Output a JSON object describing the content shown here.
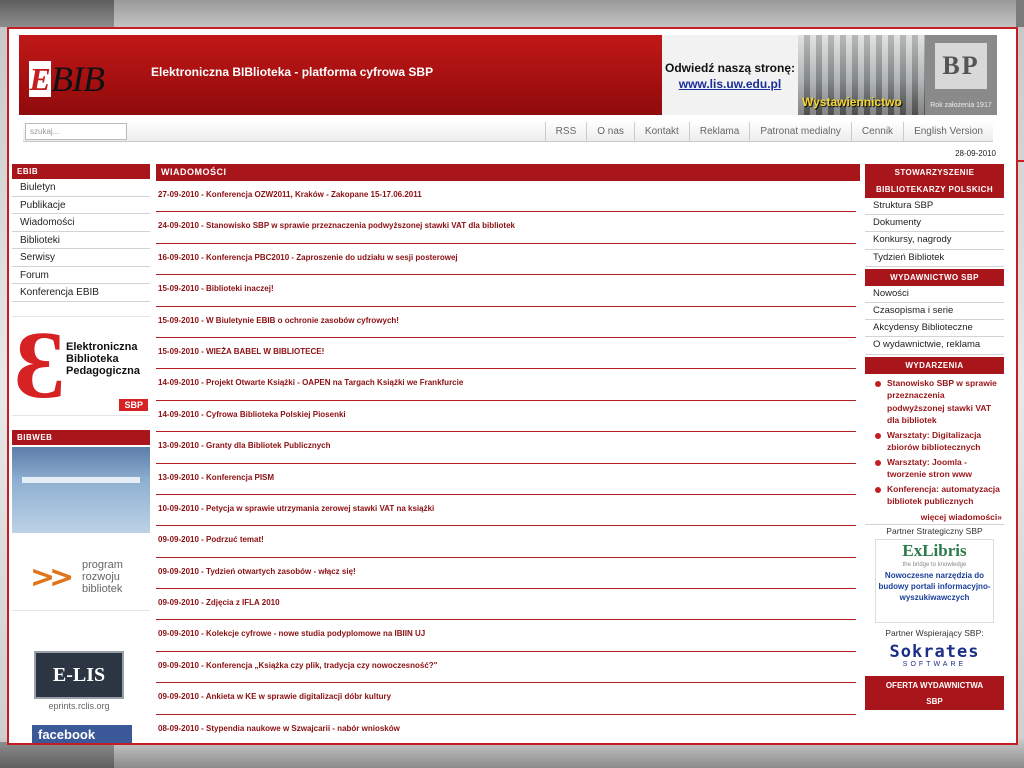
{
  "header": {
    "logo_e": "E",
    "logo_rest": "BIB",
    "title": "Elektroniczna BIBlioteka - platforma cyfrowa SBP",
    "visit_label": "Odwiedź naszą stronę:",
    "visit_url": "www.lis.uw.edu.pl",
    "photo_caption": "Wystawiennictwo",
    "sbp_mark": "BP",
    "sbp_caption": "Rok założenia 1917"
  },
  "navbar": {
    "search_placeholder": "szukaj...",
    "links": [
      "RSS",
      "O nas",
      "Kontakt",
      "Reklama",
      "Patronat medialny",
      "Cennik",
      "English Version"
    ]
  },
  "date": "28-09-2010",
  "left": {
    "ebib_head": "EBIB",
    "menu": [
      "Biuletyn",
      "Publikacje",
      "Wiadomości",
      "Biblioteki",
      "Serwisy",
      "Forum",
      "Konferencja EBIB"
    ],
    "ebp_text": [
      "Elektroniczna",
      "Biblioteka",
      "Pedagogiczna"
    ],
    "ebp_sbp": "SBP",
    "bibweb_head": "BIBWEB",
    "prog_text": [
      "program",
      "rozwoju",
      "bibliotek"
    ],
    "elis_text": "E-LIS",
    "elis_caption": "eprints.rclis.org",
    "facebook": "facebook"
  },
  "center": {
    "head": "WIADOMOŚCI",
    "news": [
      "27-09-2010 - Konferencja OZW2011, Kraków - Zakopane 15-17.06.2011",
      "24-09-2010 - Stanowisko SBP w sprawie przeznaczenia podwyższonej stawki VAT dla bibliotek",
      "16-09-2010 - Konferencja PBC2010 - Zaproszenie do udziału w sesji posterowej",
      "15-09-2010 - Biblioteki inaczej!",
      "15-09-2010 - W Biuletynie EBIB o ochronie zasobów cyfrowych!",
      "15-09-2010 - WIEŻA BABEL W BIBLIOTECE!",
      "14-09-2010 - Projekt Otwarte Książki - OAPEN na Targach Książki we Frankfurcie",
      "14-09-2010 - Cyfrowa Biblioteka Polskiej Piosenki",
      "13-09-2010 - Granty dla Bibliotek Publicznych",
      "13-09-2010 - Konferencja PISM",
      "10-09-2010 - Petycja w sprawie utrzymania zerowej stawki VAT na książki",
      "09-09-2010 - Podrzuć temat!",
      "09-09-2010 - Tydzień otwartych zasobów - włącz się!",
      "09-09-2010 - Zdjęcia z IFLA 2010",
      "09-09-2010 - Kolekcje cyfrowe - nowe studia podyplomowe na IBIIN UJ",
      "09-09-2010 - Konferencja „Książka czy plik, tradycja czy nowoczesność?\"",
      "09-09-2010 - Ankieta w KE w sprawie digitalizacji dóbr kultury",
      "08-09-2010 - Stypendia naukowe w Szwajcarii - nabór wniosków"
    ]
  },
  "right": {
    "sbp_head_1": "STOWARZYSZENIE",
    "sbp_head_2": "BIBLIOTEKARZY POLSKICH",
    "sbp_menu": [
      "Struktura SBP",
      "Dokumenty",
      "Konkursy, nagrody",
      "Tydzień Bibliotek"
    ],
    "pub_head": "WYDAWNICTWO SBP",
    "pub_menu": [
      "Nowości",
      "Czasopisma i serie",
      "Akcydensy Biblioteczne",
      "O wydawnictwie, reklama"
    ],
    "events_head": "WYDARZENIA",
    "events": [
      "Stanowisko SBP w sprawie przeznaczenia podwyższonej stawki VAT dla bibliotek",
      "Warsztaty: Digitalizacja zbiorów bibliotecznych",
      "Warsztaty: Joomla - tworzenie stron www",
      "Konferencja: automatyzacja bibliotek publicznych"
    ],
    "more": "więcej wiadomości»",
    "partner_strategic": "Partner Strategiczny SBP",
    "exlibris_logo": "ExLibris",
    "exlibris_tag": "the bridge to knowledge",
    "exlibris_desc": "Nowoczesne narzędzia do budowy portali informacyjno-wyszukiwawczych",
    "partner_support": "Partner Wspierający SBP:",
    "sokrates_logo": "Sokrates",
    "sokrates_sub": "SOFTWARE",
    "offer_1": "OFERTA WYDAWNICTWA",
    "offer_2": "SBP"
  },
  "colors": {
    "brand_red": "#a8151a",
    "frame_red": "#c41e22",
    "link_red": "#8b0f12"
  }
}
